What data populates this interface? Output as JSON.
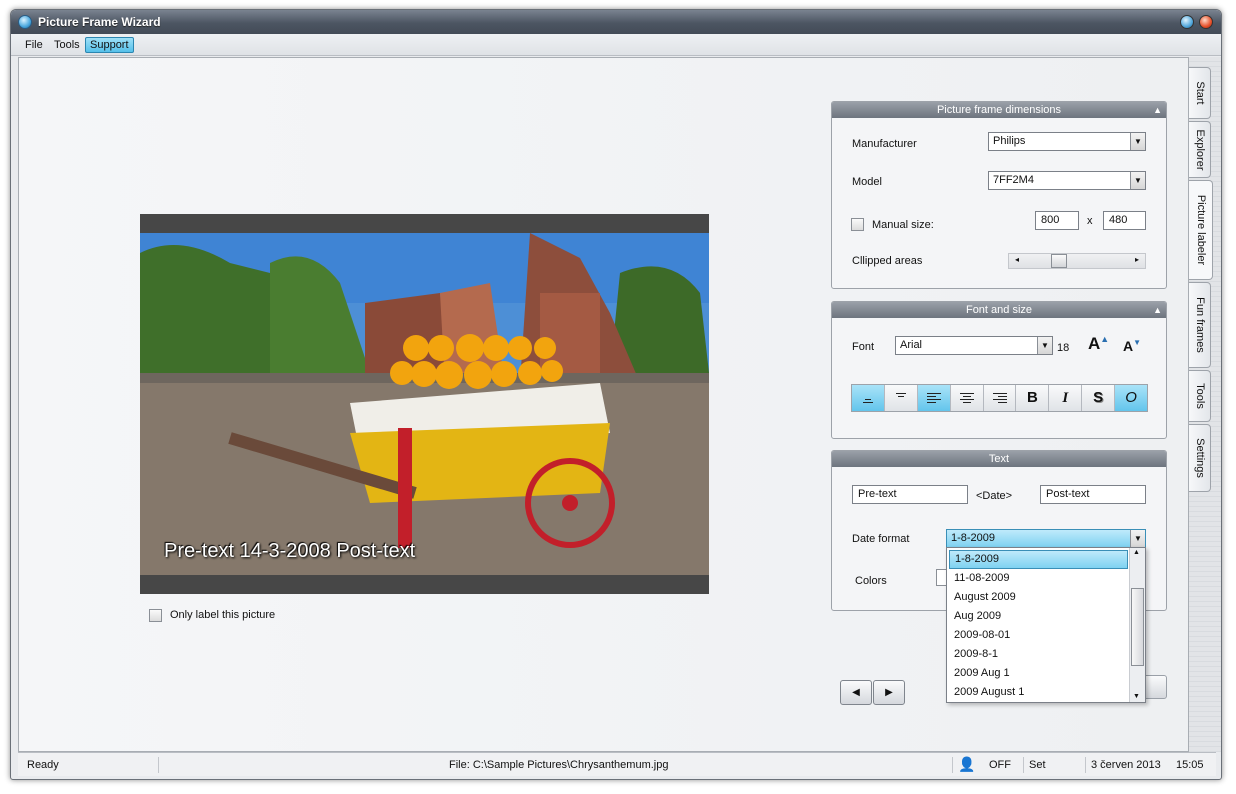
{
  "window": {
    "title": "Picture Frame Wizard"
  },
  "menu": {
    "items": [
      "File",
      "Tools",
      "Support"
    ]
  },
  "tabs": [
    "Start",
    "Explorer",
    "Picture labeler",
    "Fun frames",
    "Tools",
    "Settings"
  ],
  "picture": {
    "overlay_text": "Pre-text 14-3-2008 Post-text",
    "only_label_this": "Only label this picture"
  },
  "dimensions": {
    "header": "Picture frame dimensions",
    "manufacturer_label": "Manufacturer",
    "manufacturer_value": "Philips",
    "model_label": "Model",
    "model_value": "7FF2M4",
    "manual_size_label": "Manual size:",
    "width": "800",
    "x_label": "x",
    "height": "480",
    "clipped_label": "Cllipped areas"
  },
  "font": {
    "header": "Font and size",
    "font_label": "Font",
    "font_value": "Arial",
    "size": "18",
    "tool_buttons": [
      "B",
      "I",
      "S",
      "O"
    ]
  },
  "text": {
    "header": "Text",
    "pre_text": "Pre-text",
    "date_tag": "<Date>",
    "post_text": "Post-text",
    "date_format_label": "Date format",
    "date_format_value": "1-8-2009",
    "colors_label": "Colors",
    "date_options": [
      "1-8-2009",
      "11-08-2009",
      "August 2009",
      "Aug 2009",
      "2009-08-01",
      "2009-8-1",
      "2009 Aug 1",
      "2009 August 1"
    ]
  },
  "status": {
    "ready": "Ready",
    "file": "File: C:\\Sample Pictures\\Chrysanthemum.jpg",
    "off": "OFF",
    "set": "Set",
    "date": "3 červen 2013",
    "time": "15:05"
  },
  "colors": {
    "accent": "#6cc8ee",
    "title_bar": "#4c5562",
    "group_header": "#7d848d"
  }
}
